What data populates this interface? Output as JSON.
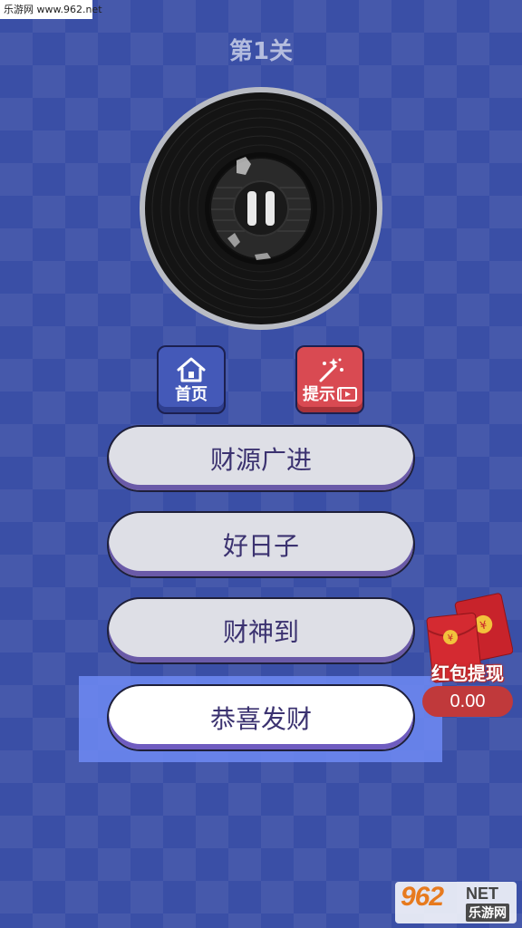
{
  "watermark_top": "乐游网 www.962.net",
  "level": {
    "title": "第1关"
  },
  "toolbar": {
    "home_label": "首页",
    "hint_label": "提示"
  },
  "answers": [
    {
      "label": "财源广进"
    },
    {
      "label": "好日子"
    },
    {
      "label": "财神到"
    },
    {
      "label": "恭喜发财"
    }
  ],
  "red_packet": {
    "title": "红包提现",
    "amount": "0.00"
  },
  "watermark_bottom": {
    "brand": "962",
    "suffix": "NET",
    "subtitle": "乐游网"
  },
  "colors": {
    "background": "#3a4fa6",
    "home_button": "#4459b8",
    "hint_button": "#d94a52",
    "answer_text": "#3b3270",
    "highlight": "#6b86f0"
  },
  "icons": [
    "house-icon",
    "magic-wand-icon",
    "video-icon",
    "pause-icon",
    "red-packet-icon"
  ]
}
